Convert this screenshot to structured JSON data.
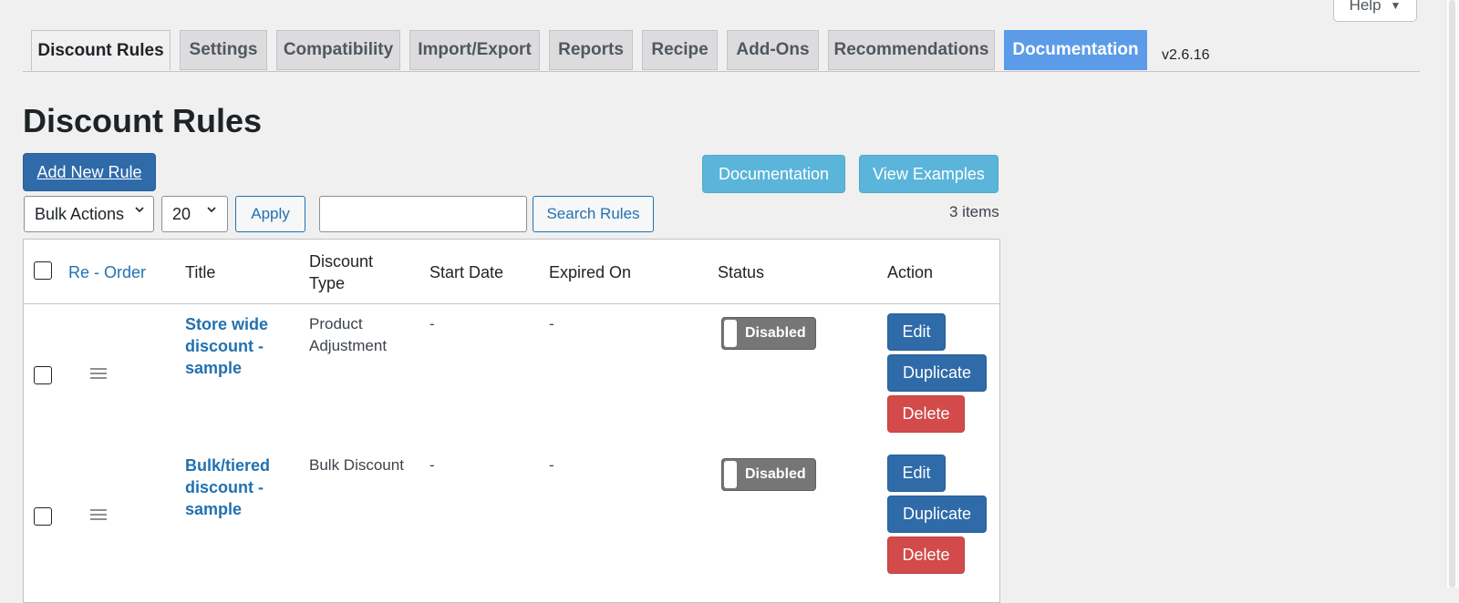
{
  "help": {
    "label": "Help",
    "caret": "▼"
  },
  "tabs": [
    {
      "label": "Discount Rules",
      "active": true
    },
    {
      "label": "Settings"
    },
    {
      "label": "Compatibility"
    },
    {
      "label": "Import/Export"
    },
    {
      "label": "Reports"
    },
    {
      "label": "Recipe"
    },
    {
      "label": "Add-Ons"
    },
    {
      "label": "Recommendations"
    },
    {
      "label": "Documentation"
    }
  ],
  "version": "v2.6.16",
  "page": {
    "title": "Discount Rules",
    "add_new_label": "Add New Rule",
    "documentation_label": "Documentation",
    "view_examples_label": "View Examples"
  },
  "filters": {
    "bulk_actions": "Bulk Actions",
    "per_page": "20",
    "apply_label": "Apply",
    "search_value": "",
    "search_label": "Search Rules",
    "items_count": "3 items"
  },
  "table": {
    "headers": {
      "reorder": "Re - Order",
      "title": "Title",
      "discount_type_line1": "Discount",
      "discount_type_line2": "Type",
      "start_date": "Start Date",
      "expired_on": "Expired On",
      "status": "Status",
      "action": "Action"
    },
    "rows": [
      {
        "title": "Store wide discount - sample",
        "discount_type": "Product Adjustment",
        "start_date": "-",
        "expired_on": "-",
        "status": "Disabled",
        "edit": "Edit",
        "duplicate": "Duplicate",
        "delete": "Delete"
      },
      {
        "title": "Bulk/tiered discount - sample",
        "discount_type": "Bulk Discount",
        "start_date": "-",
        "expired_on": "-",
        "status": "Disabled",
        "edit": "Edit",
        "duplicate": "Duplicate",
        "delete": "Delete"
      }
    ]
  },
  "colors": {
    "primary": "#2f6aa9",
    "info": "#5bb5da",
    "danger": "#d24a49",
    "link": "#2271b1",
    "doc_tab": "#5b9be8"
  }
}
